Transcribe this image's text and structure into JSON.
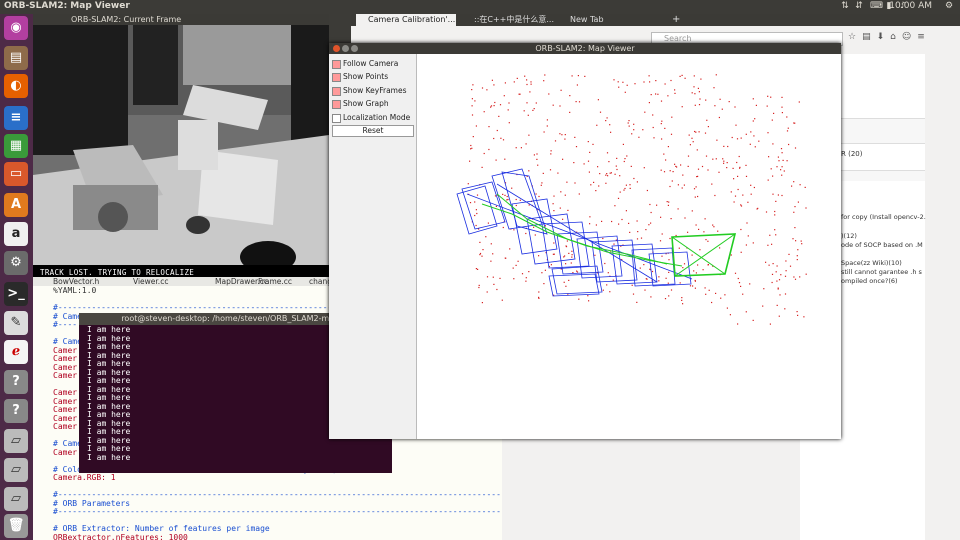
{
  "top_panel": {
    "title": "ORB-SLAM2: Map Viewer",
    "clock": "10:00 AM"
  },
  "launcher": {
    "icons": [
      "ubuntu-icon",
      "files-icon",
      "firefox-icon",
      "writer-icon",
      "calc-icon",
      "impress-icon",
      "software-center-icon",
      "amazon-icon",
      "settings-icon",
      "terminal-icon",
      "editor-icon",
      "hand-icon",
      "unknown-icon",
      "unknown-icon",
      "drive-icon",
      "drive-icon",
      "drive-icon",
      "trash-icon"
    ]
  },
  "camera_window": {
    "title": "ORB-SLAM2: Current Frame",
    "status": "TRACK LOST. TRYING TO RELOCALIZE"
  },
  "editor": {
    "tabs": [
      "BowVector.h",
      "Viewer.cc",
      "MapDrawer.cc",
      "Frame.cc",
      "chang"
    ],
    "lines": [
      {
        "text": "%YAML:1.0",
        "color": "#333"
      },
      {
        "text": "",
        "color": "#333"
      },
      {
        "text": "#--------------------------------------------------------------------------------------------",
        "color": "#1a4fd1"
      },
      {
        "text": "# Came",
        "color": "#1a4fd1"
      },
      {
        "text": "#----",
        "color": "#1a4fd1"
      },
      {
        "text": "",
        "color": "#333"
      },
      {
        "text": "# Came",
        "color": "#1a4fd1"
      },
      {
        "text": "Camer",
        "color": "#b00020"
      },
      {
        "text": "Camer",
        "color": "#b00020"
      },
      {
        "text": "Camer",
        "color": "#b00020"
      },
      {
        "text": "Camer",
        "color": "#b00020"
      },
      {
        "text": "",
        "color": "#333"
      },
      {
        "text": "Camer",
        "color": "#b00020"
      },
      {
        "text": "Camer",
        "color": "#b00020"
      },
      {
        "text": "Camer",
        "color": "#b00020"
      },
      {
        "text": "Camer",
        "color": "#b00020"
      },
      {
        "text": "Camer",
        "color": "#b00020"
      },
      {
        "text": "",
        "color": "#333"
      },
      {
        "text": "# Came",
        "color": "#1a4fd1"
      },
      {
        "text": "Camer",
        "color": "#b00020"
      },
      {
        "text": "",
        "color": "#333"
      },
      {
        "text": "# Colo                                              yscale)",
        "color": "#1a4fd1"
      },
      {
        "text": "Camera.RGB: 1",
        "color": "#b00020"
      },
      {
        "text": "",
        "color": "#333"
      },
      {
        "text": "#--------------------------------------------------------------------------------------------",
        "color": "#1a4fd1"
      },
      {
        "text": "# ORB Parameters",
        "color": "#1a4fd1"
      },
      {
        "text": "#--------------------------------------------------------------------------------------------",
        "color": "#1a4fd1"
      },
      {
        "text": "",
        "color": "#333"
      },
      {
        "text": "# ORB Extractor: Number of features per image",
        "color": "#1a4fd1"
      },
      {
        "text": "ORBextractor.nFeatures: 1000",
        "color": "#b00020"
      }
    ]
  },
  "terminal": {
    "title": "root@steven-desktop: /home/steven/ORB_SLAM2-master",
    "lines": [
      "I am here",
      "I am here",
      "I am here",
      "I am here",
      "I am here",
      "I am here",
      "I am here",
      "I am here",
      "I am here",
      "I am here",
      "I am here",
      "I am here",
      "I am here",
      "I am here",
      "I am here",
      "I am here"
    ]
  },
  "browser": {
    "tabs": [
      "Camera Calibration'...",
      "::在C++中是什么意...",
      "New Tab"
    ],
    "search_placeholder": "Search",
    "sidebar_items": [
      "R (20)",
      "for copy (Install opencv-2.",
      ")(12)",
      "ode of SOCP based on .M",
      "Space(zz Wiki)(10)",
      "still cannot garantee .h s",
      "ompiled once?(6)"
    ]
  },
  "map_viewer": {
    "title": "ORB-SLAM2: Map Viewer",
    "options": [
      {
        "label": "Follow Camera",
        "checked": true
      },
      {
        "label": "Show Points",
        "checked": true
      },
      {
        "label": "Show KeyFrames",
        "checked": true
      },
      {
        "label": "Show Graph",
        "checked": true
      },
      {
        "label": "Localization Mode",
        "checked": false
      }
    ],
    "reset_label": "Reset"
  },
  "colors": {
    "launcher_bg": "#4d2a47",
    "terminal_bg": "#300a24",
    "map_points": "#d62020",
    "keyframes": "#1a2ee0",
    "graph": "#22cc22"
  }
}
